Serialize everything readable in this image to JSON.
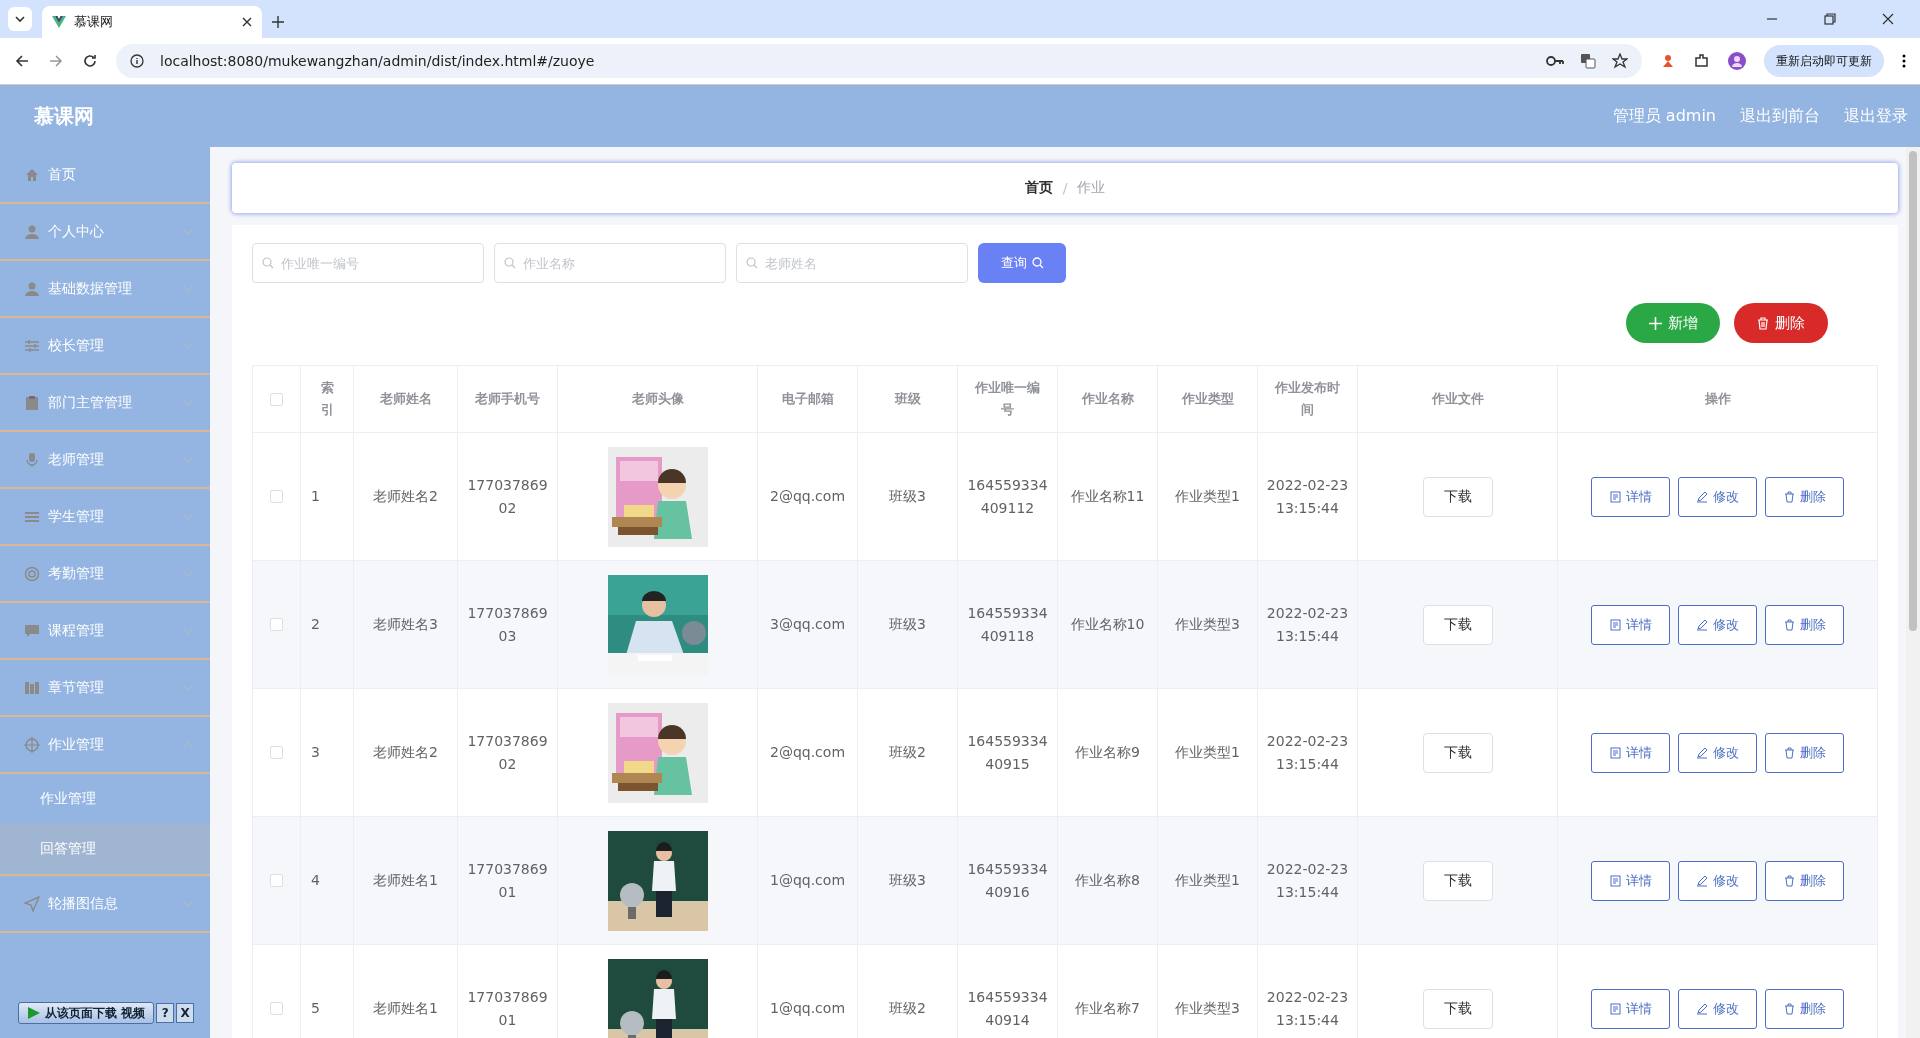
{
  "browser": {
    "tab_title": "慕课网",
    "url": "localhost:8080/mukewangzhan/admin/dist/index.html#/zuoye",
    "update_button": "重新启动即可更新"
  },
  "header": {
    "logo": "慕课网",
    "links": [
      "管理员 admin",
      "退出到前台",
      "退出登录"
    ]
  },
  "sidebar": {
    "items": [
      {
        "label": "首页",
        "selected": false
      },
      {
        "label": "个人中心",
        "expanded": false
      },
      {
        "label": "基础数据管理",
        "expanded": false
      },
      {
        "label": "校长管理",
        "expanded": false
      },
      {
        "label": "部门主管管理",
        "expanded": false
      },
      {
        "label": "老师管理",
        "expanded": false
      },
      {
        "label": "学生管理",
        "expanded": false
      },
      {
        "label": "考勤管理",
        "expanded": false
      },
      {
        "label": "课程管理",
        "expanded": false
      },
      {
        "label": "章节管理",
        "expanded": false
      },
      {
        "label": "作业管理",
        "expanded": true,
        "children": [
          {
            "label": "作业管理",
            "selected": false
          },
          {
            "label": "回答管理",
            "selected": true
          }
        ]
      },
      {
        "label": "轮播图信息",
        "expanded": false
      }
    ]
  },
  "breadcrumb": {
    "items": [
      "首页",
      "作业"
    ],
    "separator": "/"
  },
  "search": {
    "fields": [
      {
        "placeholder": "作业唯一编号"
      },
      {
        "placeholder": "作业名称"
      },
      {
        "placeholder": "老师姓名"
      }
    ],
    "button": "查询"
  },
  "actions": {
    "add": "新增",
    "delete": "删除"
  },
  "table": {
    "columns": [
      "索引",
      "老师姓名",
      "老师手机号",
      "老师头像",
      "电子邮箱",
      "班级",
      "作业唯一编号",
      "作业名称",
      "作业类型",
      "作业发布时间",
      "作业文件",
      "操作"
    ],
    "all_checked": false,
    "rows": [
      {
        "checked": false,
        "index": "1",
        "name": "老师姓名2",
        "phone": "17703786902",
        "email": "2@qq.com",
        "class": "班级3",
        "code": "164559334409112",
        "title": "作业名称11",
        "type": "作业类型1",
        "date": "2022-02-23",
        "time": "13:15:44",
        "file": "下载",
        "ops": [
          "详情",
          "修改",
          "删除"
        ]
      },
      {
        "checked": false,
        "index": "2",
        "name": "老师姓名3",
        "phone": "17703786903",
        "email": "3@qq.com",
        "class": "班级3",
        "code": "164559334409118",
        "title": "作业名称10",
        "type": "作业类型3",
        "date": "2022-02-23",
        "time": "13:15:44",
        "file": "下载",
        "ops": [
          "详情",
          "修改",
          "删除"
        ]
      },
      {
        "checked": false,
        "index": "3",
        "name": "老师姓名2",
        "phone": "17703786902",
        "email": "2@qq.com",
        "class": "班级2",
        "code": "16455933440915",
        "title": "作业名称9",
        "type": "作业类型1",
        "date": "2022-02-23",
        "time": "13:15:44",
        "file": "下载",
        "ops": [
          "详情",
          "修改",
          "删除"
        ]
      },
      {
        "checked": false,
        "index": "4",
        "name": "老师姓名1",
        "phone": "17703786901",
        "email": "1@qq.com",
        "class": "班级3",
        "code": "16455933440916",
        "title": "作业名称8",
        "type": "作业类型1",
        "date": "2022-02-23",
        "time": "13:15:44",
        "file": "下载",
        "ops": [
          "详情",
          "修改",
          "删除"
        ]
      },
      {
        "checked": false,
        "index": "5",
        "name": "老师姓名1",
        "phone": "17703786901",
        "email": "1@qq.com",
        "class": "班级2",
        "code": "16455933440914",
        "title": "作业名称7",
        "type": "作业类型3",
        "date": "2022-02-23",
        "time": "13:15:44",
        "file": "下载",
        "ops": [
          "详情",
          "修改",
          "删除"
        ]
      }
    ]
  },
  "download_bar": {
    "label": "从该页面下载 视频",
    "help": "?",
    "close": "X"
  }
}
